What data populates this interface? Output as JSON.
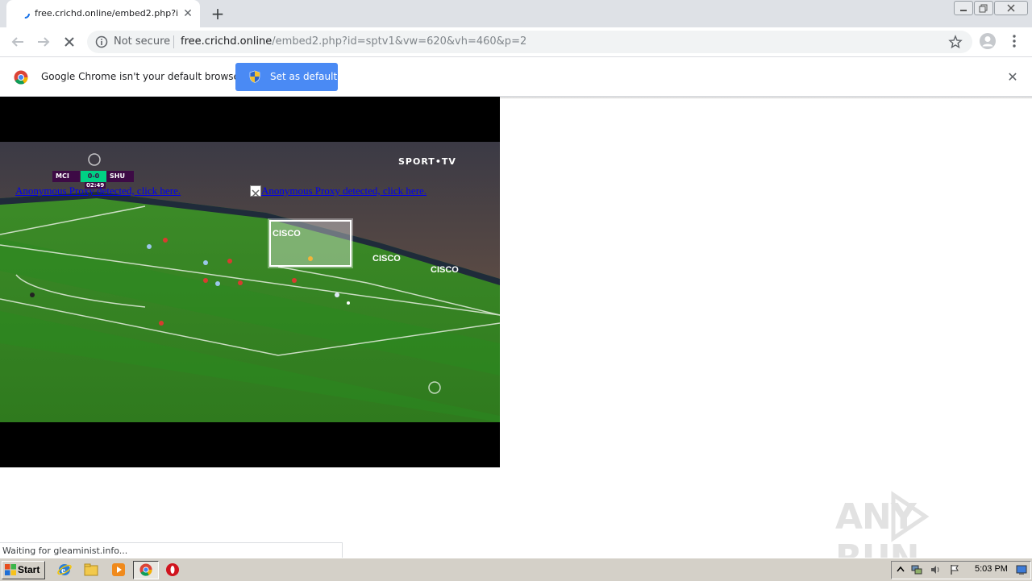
{
  "browser": {
    "tab": {
      "title": "free.crichd.online/embed2.php?id=sptv1&vw=620&vh=460&p=2"
    },
    "omnibox": {
      "security_label": "Not secure",
      "url_host": "free.crichd.online",
      "url_rest": "/embed2.php?id=sptv1&vw=620&vh=460&p=2"
    },
    "infobar": {
      "message": "Google Chrome isn't your default browser",
      "button_label": "Set as default"
    },
    "status": "Waiting for gleaminist.info..."
  },
  "page": {
    "scoreboard": {
      "home": "MCI",
      "score": "0-0",
      "away": "SHU",
      "time": "02:49"
    },
    "channel_logo": "SPORT•TV",
    "links": [
      "Anonymous Proxy detected, click here.",
      "Anonymous Proxy detected, click here."
    ]
  },
  "watermark": "ANY RUN",
  "taskbar": {
    "start_label": "Start",
    "clock": "5:03 PM"
  },
  "colors": {
    "accent": "#4a8af4",
    "tabstrip": "#dee1e6",
    "link": "#0000ee",
    "taskbar": "#d4d0c8"
  }
}
